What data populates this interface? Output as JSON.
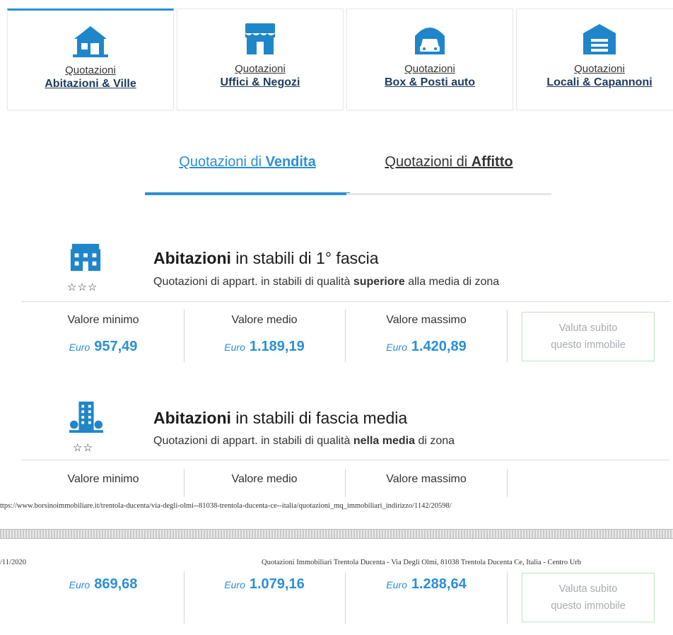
{
  "categories": [
    {
      "kicker": "Quotazioni",
      "title": "Abitazioni & Ville",
      "icon": "house-icon",
      "active": true
    },
    {
      "kicker": "Quotazioni",
      "title": "Uffici & Negozi",
      "icon": "shop-icon",
      "active": false
    },
    {
      "kicker": "Quotazioni",
      "title": "Box & Posti auto",
      "icon": "garage-car-icon",
      "active": false
    },
    {
      "kicker": "Quotazioni",
      "title": "Locali & Capannoni",
      "icon": "warehouse-icon",
      "active": false
    }
  ],
  "tabs": [
    {
      "prefix": "Quotazioni di ",
      "bold": "Vendita",
      "active": true
    },
    {
      "prefix": "Quotazioni di ",
      "bold": "Affitto",
      "active": false
    }
  ],
  "sections": [
    {
      "title_bold": "Abitazioni",
      "title_rest": " in stabili di 1° fascia",
      "sub_pre": "Quotazioni di appart. in stabili di qualità ",
      "sub_bold": "superiore",
      "sub_post": " alla media di zona",
      "stars": "☆☆☆",
      "labels": [
        "Valore minimo",
        "Valore medio",
        "Valore massimo"
      ],
      "currency": "Euro",
      "values": [
        "957,49",
        "1.189,19",
        "1.420,89"
      ],
      "button_line1": "Valuta subito",
      "button_line2": "questo immobile"
    },
    {
      "title_bold": "Abitazioni",
      "title_rest": " in stabili di fascia media",
      "sub_pre": "Quotazioni di appart. in stabili di qualità ",
      "sub_bold": "nella media",
      "sub_post": " di zona",
      "stars": "☆☆",
      "labels": [
        "Valore minimo",
        "Valore medio",
        "Valore massimo"
      ],
      "currency": "Euro",
      "values": [
        "869,68",
        "1.079,16",
        "1.288,64"
      ],
      "button_line1": "Valuta subito",
      "button_line2": "questo immobile"
    }
  ],
  "print": {
    "url": "ttps://www.borsinoimmobiliare.it/trentola-ducenta/via-degli-olmi--81038-trentola-ducenta-ce--italia/quotazioni_mq_immobiliari_indirizzo/1142/20598/",
    "date": "/11/2020",
    "title": "Quotazioni Immobiliari Trentola Ducenta - Via Degli Olmi, 81038 Trentola Ducenta Ce, Italia - Centro Urb"
  },
  "colors": {
    "accent": "#2b8fd6",
    "dark": "#1d3b5c",
    "button_border": "#bfe3c3"
  }
}
